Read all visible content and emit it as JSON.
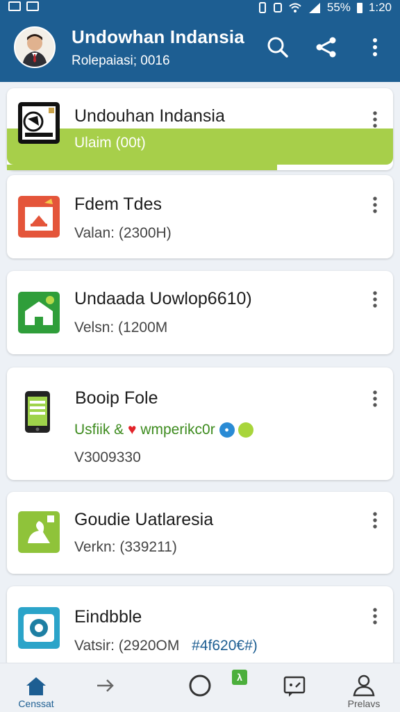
{
  "status_bar": {
    "battery": "55%",
    "time": "1:20"
  },
  "app_bar": {
    "title": "Undowhan Indansia",
    "subtitle": "Rolepaiasi; 0016",
    "icons": [
      "search-icon",
      "share-icon",
      "more-vert-icon"
    ]
  },
  "downloads": [
    {
      "title": "Undouhan Indansia",
      "subtitle": "Ulaim (00t)",
      "progress": 0.7,
      "icon": "film-reel-icon"
    },
    {
      "title": "Fdem Tdes",
      "subtitle": "Valan: (2300H)",
      "icon": "calendar-icon"
    },
    {
      "title": "Undaada Uowlop6610)",
      "subtitle": "Velsn: (1200M",
      "icon": "house-icon"
    },
    {
      "title": "Booip Fole",
      "subtitle_parts": {
        "before": "Usfiik &",
        "after": "wmperikc0r"
      },
      "extra": "V3009330",
      "icon": "phone-icon"
    },
    {
      "title": "Goudie Uatlaresia",
      "subtitle": "Verkn: (339211)",
      "icon": "edit-icon"
    },
    {
      "title": "Eindbble",
      "subtitle": "Vatsir: (2920OM",
      "tag": "#4f620€#)",
      "icon": "camera-icon"
    }
  ],
  "bottom_nav": {
    "items": [
      {
        "label": "Censsat",
        "icon": "home-icon",
        "active": true
      },
      {
        "label": "",
        "icon": "arrow-right-icon"
      },
      {
        "label": "",
        "icon": "circle-icon"
      },
      {
        "label": "",
        "icon": "message-icon"
      },
      {
        "label": "Prelavs",
        "icon": "person-icon"
      }
    ],
    "badge": "λ"
  },
  "colors": {
    "primary": "#1d5e92",
    "progress": "#a7cf4a",
    "accent_green": "#3d8b1e"
  }
}
